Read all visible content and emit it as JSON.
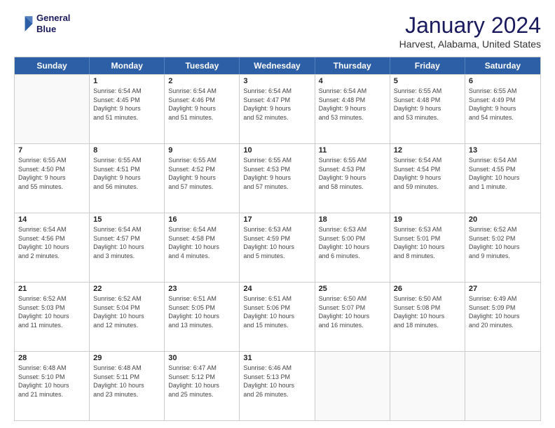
{
  "header": {
    "logo_line1": "General",
    "logo_line2": "Blue",
    "main_title": "January 2024",
    "subtitle": "Harvest, Alabama, United States"
  },
  "calendar": {
    "days_of_week": [
      "Sunday",
      "Monday",
      "Tuesday",
      "Wednesday",
      "Thursday",
      "Friday",
      "Saturday"
    ],
    "weeks": [
      [
        {
          "day": "",
          "info": ""
        },
        {
          "day": "1",
          "info": "Sunrise: 6:54 AM\nSunset: 4:45 PM\nDaylight: 9 hours\nand 51 minutes."
        },
        {
          "day": "2",
          "info": "Sunrise: 6:54 AM\nSunset: 4:46 PM\nDaylight: 9 hours\nand 51 minutes."
        },
        {
          "day": "3",
          "info": "Sunrise: 6:54 AM\nSunset: 4:47 PM\nDaylight: 9 hours\nand 52 minutes."
        },
        {
          "day": "4",
          "info": "Sunrise: 6:54 AM\nSunset: 4:48 PM\nDaylight: 9 hours\nand 53 minutes."
        },
        {
          "day": "5",
          "info": "Sunrise: 6:55 AM\nSunset: 4:48 PM\nDaylight: 9 hours\nand 53 minutes."
        },
        {
          "day": "6",
          "info": "Sunrise: 6:55 AM\nSunset: 4:49 PM\nDaylight: 9 hours\nand 54 minutes."
        }
      ],
      [
        {
          "day": "7",
          "info": "Sunrise: 6:55 AM\nSunset: 4:50 PM\nDaylight: 9 hours\nand 55 minutes."
        },
        {
          "day": "8",
          "info": "Sunrise: 6:55 AM\nSunset: 4:51 PM\nDaylight: 9 hours\nand 56 minutes."
        },
        {
          "day": "9",
          "info": "Sunrise: 6:55 AM\nSunset: 4:52 PM\nDaylight: 9 hours\nand 57 minutes."
        },
        {
          "day": "10",
          "info": "Sunrise: 6:55 AM\nSunset: 4:53 PM\nDaylight: 9 hours\nand 57 minutes."
        },
        {
          "day": "11",
          "info": "Sunrise: 6:55 AM\nSunset: 4:53 PM\nDaylight: 9 hours\nand 58 minutes."
        },
        {
          "day": "12",
          "info": "Sunrise: 6:54 AM\nSunset: 4:54 PM\nDaylight: 9 hours\nand 59 minutes."
        },
        {
          "day": "13",
          "info": "Sunrise: 6:54 AM\nSunset: 4:55 PM\nDaylight: 10 hours\nand 1 minute."
        }
      ],
      [
        {
          "day": "14",
          "info": "Sunrise: 6:54 AM\nSunset: 4:56 PM\nDaylight: 10 hours\nand 2 minutes."
        },
        {
          "day": "15",
          "info": "Sunrise: 6:54 AM\nSunset: 4:57 PM\nDaylight: 10 hours\nand 3 minutes."
        },
        {
          "day": "16",
          "info": "Sunrise: 6:54 AM\nSunset: 4:58 PM\nDaylight: 10 hours\nand 4 minutes."
        },
        {
          "day": "17",
          "info": "Sunrise: 6:53 AM\nSunset: 4:59 PM\nDaylight: 10 hours\nand 5 minutes."
        },
        {
          "day": "18",
          "info": "Sunrise: 6:53 AM\nSunset: 5:00 PM\nDaylight: 10 hours\nand 6 minutes."
        },
        {
          "day": "19",
          "info": "Sunrise: 6:53 AM\nSunset: 5:01 PM\nDaylight: 10 hours\nand 8 minutes."
        },
        {
          "day": "20",
          "info": "Sunrise: 6:52 AM\nSunset: 5:02 PM\nDaylight: 10 hours\nand 9 minutes."
        }
      ],
      [
        {
          "day": "21",
          "info": "Sunrise: 6:52 AM\nSunset: 5:03 PM\nDaylight: 10 hours\nand 11 minutes."
        },
        {
          "day": "22",
          "info": "Sunrise: 6:52 AM\nSunset: 5:04 PM\nDaylight: 10 hours\nand 12 minutes."
        },
        {
          "day": "23",
          "info": "Sunrise: 6:51 AM\nSunset: 5:05 PM\nDaylight: 10 hours\nand 13 minutes."
        },
        {
          "day": "24",
          "info": "Sunrise: 6:51 AM\nSunset: 5:06 PM\nDaylight: 10 hours\nand 15 minutes."
        },
        {
          "day": "25",
          "info": "Sunrise: 6:50 AM\nSunset: 5:07 PM\nDaylight: 10 hours\nand 16 minutes."
        },
        {
          "day": "26",
          "info": "Sunrise: 6:50 AM\nSunset: 5:08 PM\nDaylight: 10 hours\nand 18 minutes."
        },
        {
          "day": "27",
          "info": "Sunrise: 6:49 AM\nSunset: 5:09 PM\nDaylight: 10 hours\nand 20 minutes."
        }
      ],
      [
        {
          "day": "28",
          "info": "Sunrise: 6:48 AM\nSunset: 5:10 PM\nDaylight: 10 hours\nand 21 minutes."
        },
        {
          "day": "29",
          "info": "Sunrise: 6:48 AM\nSunset: 5:11 PM\nDaylight: 10 hours\nand 23 minutes."
        },
        {
          "day": "30",
          "info": "Sunrise: 6:47 AM\nSunset: 5:12 PM\nDaylight: 10 hours\nand 25 minutes."
        },
        {
          "day": "31",
          "info": "Sunrise: 6:46 AM\nSunset: 5:13 PM\nDaylight: 10 hours\nand 26 minutes."
        },
        {
          "day": "",
          "info": ""
        },
        {
          "day": "",
          "info": ""
        },
        {
          "day": "",
          "info": ""
        }
      ]
    ]
  }
}
